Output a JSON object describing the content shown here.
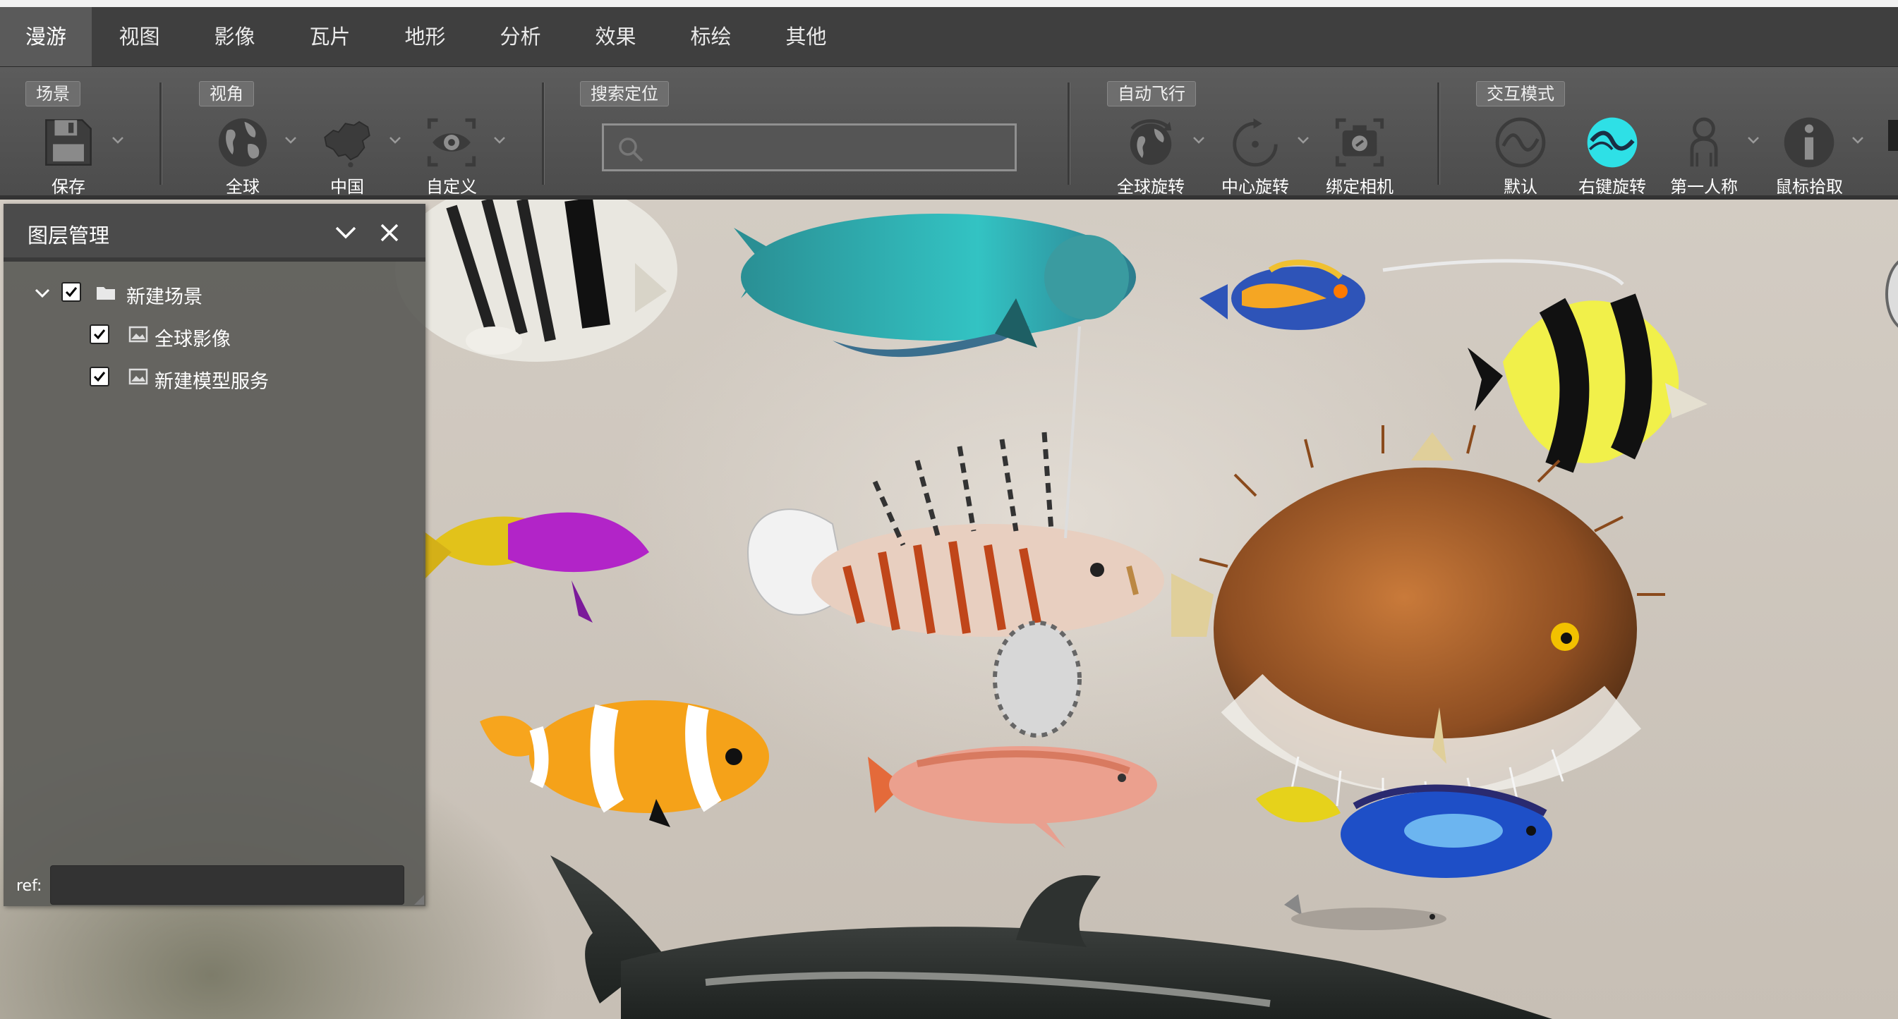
{
  "menu": {
    "tabs": [
      {
        "label": "漫游",
        "active": true
      },
      {
        "label": "视图",
        "active": false
      },
      {
        "label": "影像",
        "active": false
      },
      {
        "label": "瓦片",
        "active": false
      },
      {
        "label": "地形",
        "active": false
      },
      {
        "label": "分析",
        "active": false
      },
      {
        "label": "效果",
        "active": false
      },
      {
        "label": "标绘",
        "active": false
      },
      {
        "label": "其他",
        "active": false
      }
    ]
  },
  "ribbon": {
    "scene": {
      "label": "场景",
      "save": "保存"
    },
    "view": {
      "label": "视角",
      "global": "全球",
      "china": "中国",
      "custom": "自定义"
    },
    "search": {
      "label": "搜索定位",
      "placeholder": "",
      "value": ""
    },
    "autofly": {
      "label": "自动飞行",
      "global_rotate": "全球旋转",
      "center_rotate": "中心旋转",
      "bind_camera": "绑定相机"
    },
    "interaction": {
      "label": "交互模式",
      "default": "默认",
      "right_rotate": "右键旋转",
      "first_person": "第一人称",
      "pick": "鼠标拾取"
    }
  },
  "icons": {
    "save": "save-icon",
    "globe": "globe-icon",
    "china": "china-map-icon",
    "eye": "eye-icon",
    "search": "search-icon",
    "rotate_globe": "globe-rotate-icon",
    "rotate_center": "center-rotate-icon",
    "camera": "bind-camera-icon",
    "default_mode": "wave-icon",
    "right_rotate": "right-rotate-icon",
    "person": "person-icon",
    "info": "info-icon"
  },
  "colors": {
    "accent": "#2ee0e6",
    "menu_bg": "#3f3f3f",
    "ribbon_bg": "#555555",
    "panel_bg": "#5c5c58"
  },
  "layer_panel": {
    "title": "图层管理",
    "tree": [
      {
        "label": "新建场景",
        "checked": true,
        "type": "folder",
        "level": 0,
        "expanded": true
      },
      {
        "label": "全球影像",
        "checked": true,
        "type": "image",
        "level": 1
      },
      {
        "label": "新建模型服务",
        "checked": true,
        "type": "image",
        "level": 1
      }
    ],
    "ref_label": "ref:",
    "ref_value": ""
  }
}
